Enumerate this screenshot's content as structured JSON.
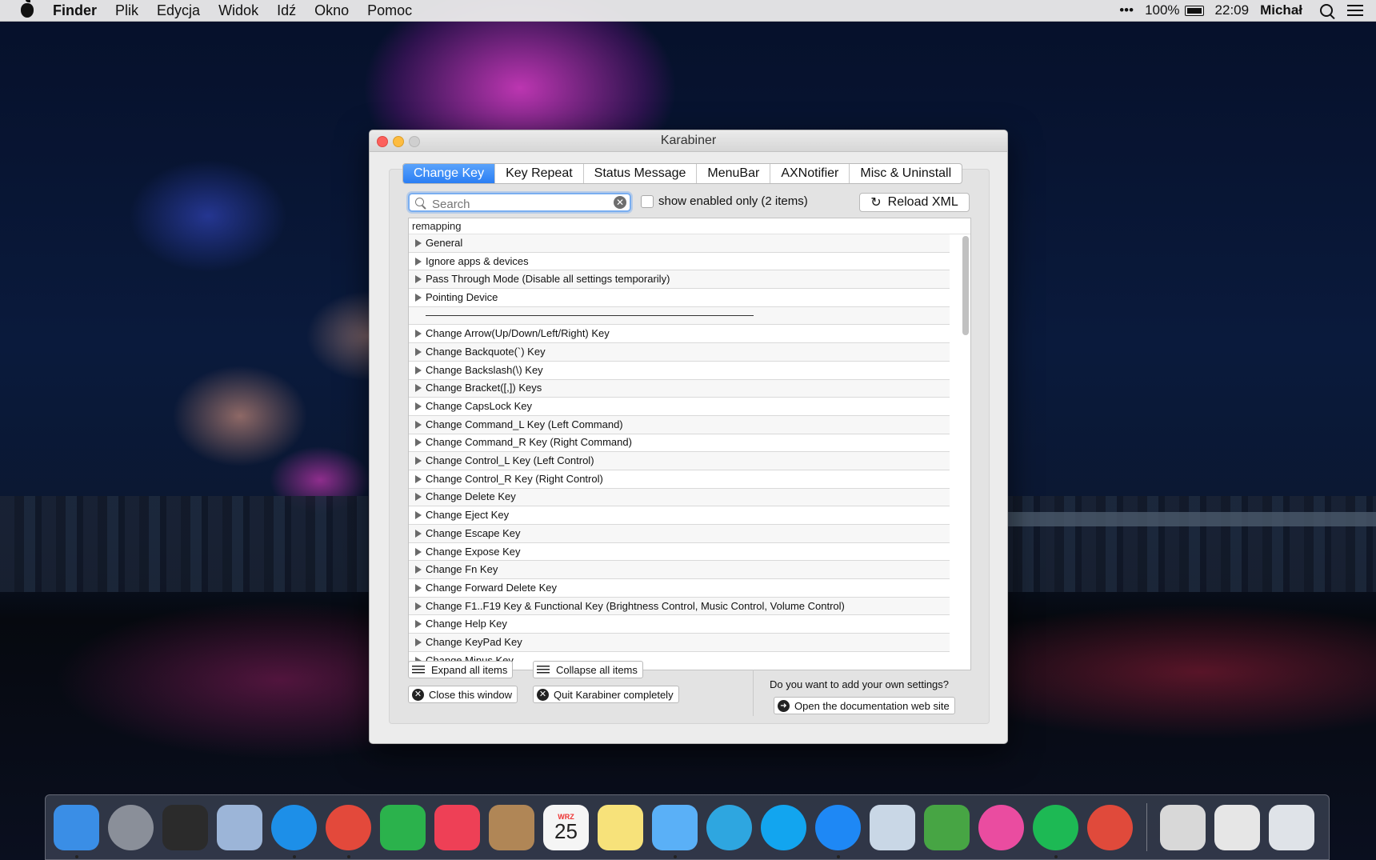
{
  "menubar": {
    "app": "Finder",
    "items": [
      "Plik",
      "Edycja",
      "Widok",
      "Idź",
      "Okno",
      "Pomoc"
    ],
    "dots": "•••",
    "battery": "100%",
    "time": "22:09",
    "user": "Michał"
  },
  "window": {
    "title": "Karabiner",
    "tabs": [
      "Change Key",
      "Key Repeat",
      "Status Message",
      "MenuBar",
      "AXNotifier",
      "Misc & Uninstall"
    ],
    "active_tab": "Change Key",
    "search_placeholder": "Search",
    "show_enabled_label": "show enabled only (2 items)",
    "reload_label": "Reload XML",
    "list_header": "remapping",
    "rows": [
      "General",
      "Ignore apps & devices",
      "Pass Through Mode (Disable all settings temporarily)",
      "Pointing Device",
      "",
      "Change Arrow(Up/Down/Left/Right) Key",
      "Change Backquote(`) Key",
      "Change Backslash(\\) Key",
      "Change Bracket([,]) Keys",
      "Change CapsLock Key",
      "Change Command_L Key (Left Command)",
      "Change Command_R Key (Right Command)",
      "Change Control_L Key (Left Control)",
      "Change Control_R Key (Right Control)",
      "Change Delete Key",
      "Change Eject Key",
      "Change Escape Key",
      "Change Expose Key",
      "Change Fn Key",
      "Change Forward Delete Key",
      "Change F1..F19 Key & Functional Key (Brightness Control, Music Control, Volume Control)",
      "Change Help Key",
      "Change KeyPad Key",
      "Change Minus Key"
    ],
    "buttons": {
      "expand": "Expand all items",
      "collapse": "Collapse all items",
      "close": "Close this window",
      "quit": "Quit Karabiner completely",
      "question": "Do you want to add your own settings?",
      "docs": "Open the documentation web site"
    }
  },
  "dock": {
    "apps": [
      {
        "name": "finder-icon",
        "color": "#3a8ee6",
        "dot": true
      },
      {
        "name": "launchpad-icon",
        "color": "#8a8f99",
        "dot": false
      },
      {
        "name": "activity-monitor-icon",
        "color": "#2b2b2b",
        "dot": false
      },
      {
        "name": "mail-icon",
        "color": "#9cb5d8",
        "dot": false
      },
      {
        "name": "safari-icon",
        "color": "#1d8fe8",
        "dot": true
      },
      {
        "name": "chrome-icon",
        "color": "#e3493b",
        "dot": true
      },
      {
        "name": "feedly-icon",
        "color": "#2bb24c",
        "dot": false
      },
      {
        "name": "pocket-icon",
        "color": "#ee4056",
        "dot": false
      },
      {
        "name": "contacts-icon",
        "color": "#b08656",
        "dot": false
      },
      {
        "name": "calendar-icon",
        "color": "#f5f5f5",
        "dot": false
      },
      {
        "name": "notes-icon",
        "color": "#f7e27a",
        "dot": false
      },
      {
        "name": "messages-icon",
        "color": "#5ab0f7",
        "dot": true
      },
      {
        "name": "telegram-icon",
        "color": "#2ea6e0",
        "dot": false
      },
      {
        "name": "skype-icon",
        "color": "#12a5ef",
        "dot": false
      },
      {
        "name": "messenger-icon",
        "color": "#1e88f5",
        "dot": true
      },
      {
        "name": "preview-icon",
        "color": "#c9d7e6",
        "dot": false
      },
      {
        "name": "evernote-icon",
        "color": "#47a544",
        "dot": false
      },
      {
        "name": "itunes-icon",
        "color": "#ea4ca0",
        "dot": false
      },
      {
        "name": "spotify-icon",
        "color": "#1db954",
        "dot": true
      },
      {
        "name": "transmit-icon",
        "color": "#e04a3b",
        "dot": false
      }
    ],
    "calendar_month": "WRZ",
    "calendar_day": "25",
    "stacks": [
      {
        "name": "downloads-stack-icon",
        "color": "#d8d8d8"
      },
      {
        "name": "documents-stack-icon",
        "color": "#e6e6e6"
      },
      {
        "name": "trash-icon",
        "color": "#dfe3e8"
      }
    ]
  }
}
